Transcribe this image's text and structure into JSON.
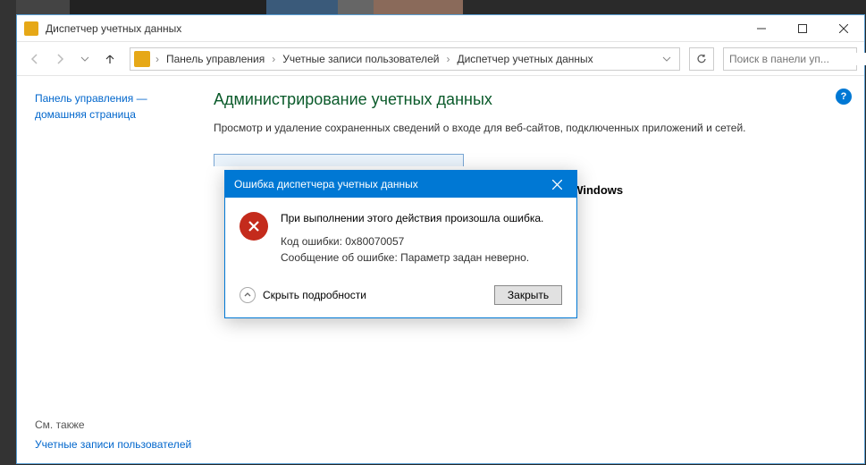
{
  "window": {
    "title": "Диспетчер учетных данных"
  },
  "breadcrumb": {
    "items": [
      "Панель управления",
      "Учетные записи пользователей",
      "Диспетчер учетных данных"
    ]
  },
  "search": {
    "placeholder": "Поиск в панели уп..."
  },
  "sidebar": {
    "home_link": "Панель управления — домашняя страница",
    "see_also_heading": "См. также",
    "see_also_link": "Учетные записи пользователей"
  },
  "main": {
    "heading": "Администрирование учетных данных",
    "description": "Просмотр и удаление сохраненных сведений о входе для веб-сайтов, подключенных приложений и сетей.",
    "bg_label_fragment": "҂ Windows",
    "help_symbol": "?"
  },
  "dialog": {
    "title": "Ошибка диспетчера учетных данных",
    "message": "При выполнении этого действия произошла ошибка.",
    "error_code_line": "Код ошибки: 0x80070057",
    "error_msg_line": "Сообщение об ошибке: Параметр задан неверно.",
    "hide_details": "Скрыть подробности",
    "close_button": "Закрыть"
  }
}
